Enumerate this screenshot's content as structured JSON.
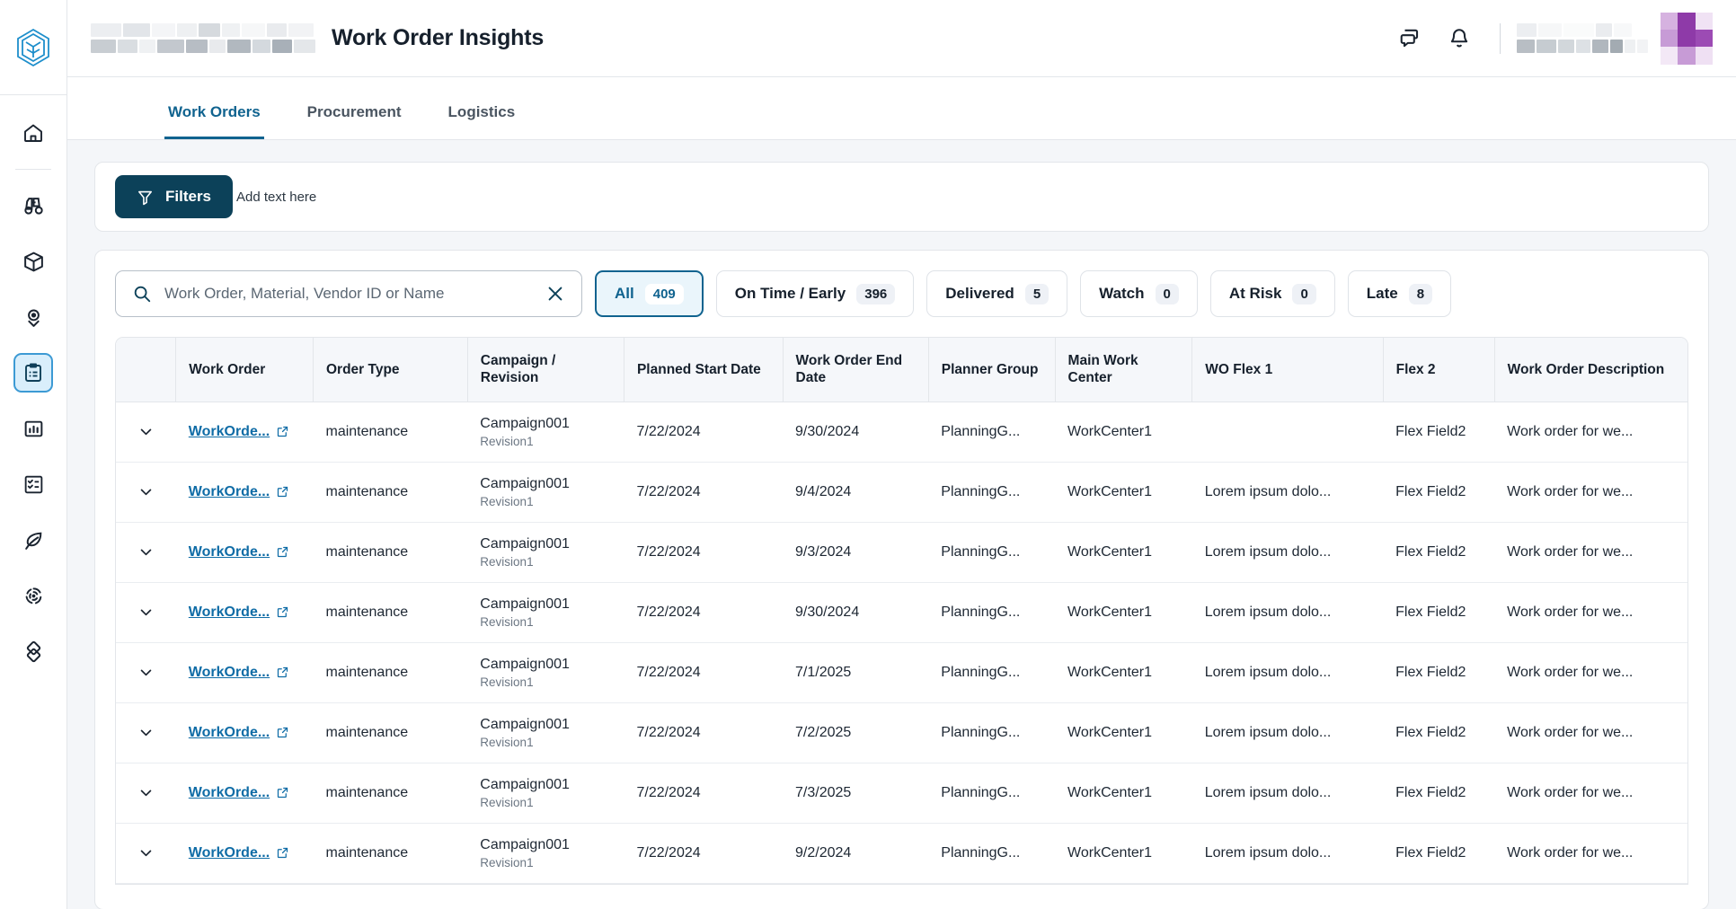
{
  "header": {
    "title": "Work Order Insights",
    "logo_icon": "cube-shield-logo-icon",
    "chat_icon": "chat-bubbles-icon",
    "bell_icon": "notification-bell-icon",
    "avatar_name": "user-avatar",
    "accent_color": "#10638f",
    "avatar_color": "#8e3aa8"
  },
  "rail": {
    "items": [
      {
        "icon": "home-icon",
        "active": false
      },
      {
        "icon": "binoculars-icon",
        "active": false
      },
      {
        "icon": "package-box-icon",
        "active": false
      },
      {
        "icon": "location-pin-icon",
        "active": false
      },
      {
        "icon": "clipboard-list-icon",
        "active": true
      },
      {
        "icon": "bar-chart-icon",
        "active": false
      },
      {
        "icon": "checklist-icon",
        "active": false
      },
      {
        "icon": "leaf-icon",
        "active": false
      },
      {
        "icon": "radar-circle-icon",
        "active": false
      },
      {
        "icon": "diamond-links-icon",
        "active": false
      }
    ]
  },
  "tabs": [
    {
      "label": "Work Orders",
      "active": true
    },
    {
      "label": "Procurement",
      "active": false
    },
    {
      "label": "Logistics",
      "active": false
    }
  ],
  "filters": {
    "button_label": "Filters",
    "funnel_icon": "funnel-filter-icon",
    "add_text": "Add text here"
  },
  "search": {
    "placeholder": "Work Order, Material, Vendor ID or Name",
    "value": "",
    "search_icon": "search-icon",
    "clear_icon": "close-x-icon"
  },
  "status_chips": [
    {
      "label": "All",
      "count": "409",
      "active": true
    },
    {
      "label": "On Time / Early",
      "count": "396",
      "active": false
    },
    {
      "label": "Delivered",
      "count": "5",
      "active": false
    },
    {
      "label": "Watch",
      "count": "0",
      "active": false
    },
    {
      "label": "At Risk",
      "count": "0",
      "active": false
    },
    {
      "label": "Late",
      "count": "8",
      "active": false
    }
  ],
  "table": {
    "columns": [
      "",
      "Work Order",
      "Order Type",
      "Campaign / Revision",
      "Planned Start Date",
      "Work Order End Date",
      "Planner Group",
      "Main Work Center",
      "WO Flex 1",
      "Flex 2",
      "Work Order Description"
    ],
    "rows": [
      {
        "work_order": "WorkOrde...",
        "order_type": "maintenance",
        "campaign": "Campaign001",
        "revision": "Revision1",
        "planned_start": "7/22/2024",
        "end_date": "9/30/2024",
        "planner_group": "PlanningG...",
        "work_center": "WorkCenter1",
        "wo_flex1": "",
        "flex2": "Flex Field2",
        "description": "Work order for we..."
      },
      {
        "work_order": "WorkOrde...",
        "order_type": "maintenance",
        "campaign": "Campaign001",
        "revision": "Revision1",
        "planned_start": "7/22/2024",
        "end_date": "9/4/2024",
        "planner_group": "PlanningG...",
        "work_center": "WorkCenter1",
        "wo_flex1": "Lorem ipsum dolo...",
        "flex2": "Flex Field2",
        "description": "Work order for we..."
      },
      {
        "work_order": "WorkOrde...",
        "order_type": "maintenance",
        "campaign": "Campaign001",
        "revision": "Revision1",
        "planned_start": "7/22/2024",
        "end_date": "9/3/2024",
        "planner_group": "PlanningG...",
        "work_center": "WorkCenter1",
        "wo_flex1": "Lorem ipsum dolo...",
        "flex2": "Flex Field2",
        "description": "Work order for we..."
      },
      {
        "work_order": "WorkOrde...",
        "order_type": "maintenance",
        "campaign": "Campaign001",
        "revision": "Revision1",
        "planned_start": "7/22/2024",
        "end_date": "9/30/2024",
        "planner_group": "PlanningG...",
        "work_center": "WorkCenter1",
        "wo_flex1": "Lorem ipsum dolo...",
        "flex2": "Flex Field2",
        "description": "Work order for we..."
      },
      {
        "work_order": "WorkOrde...",
        "order_type": "maintenance",
        "campaign": "Campaign001",
        "revision": "Revision1",
        "planned_start": "7/22/2024",
        "end_date": "7/1/2025",
        "planner_group": "PlanningG...",
        "work_center": "WorkCenter1",
        "wo_flex1": "Lorem ipsum dolo...",
        "flex2": "Flex Field2",
        "description": "Work order for we..."
      },
      {
        "work_order": "WorkOrde...",
        "order_type": "maintenance",
        "campaign": "Campaign001",
        "revision": "Revision1",
        "planned_start": "7/22/2024",
        "end_date": "7/2/2025",
        "planner_group": "PlanningG...",
        "work_center": "WorkCenter1",
        "wo_flex1": "Lorem ipsum dolo...",
        "flex2": "Flex Field2",
        "description": "Work order for we..."
      },
      {
        "work_order": "WorkOrde...",
        "order_type": "maintenance",
        "campaign": "Campaign001",
        "revision": "Revision1",
        "planned_start": "7/22/2024",
        "end_date": "7/3/2025",
        "planner_group": "PlanningG...",
        "work_center": "WorkCenter1",
        "wo_flex1": "Lorem ipsum dolo...",
        "flex2": "Flex Field2",
        "description": "Work order for we..."
      },
      {
        "work_order": "WorkOrde...",
        "order_type": "maintenance",
        "campaign": "Campaign001",
        "revision": "Revision1",
        "planned_start": "7/22/2024",
        "end_date": "9/2/2024",
        "planner_group": "PlanningG...",
        "work_center": "WorkCenter1",
        "wo_flex1": "Lorem ipsum dolo...",
        "flex2": "Flex Field2",
        "description": "Work order for we..."
      }
    ]
  }
}
